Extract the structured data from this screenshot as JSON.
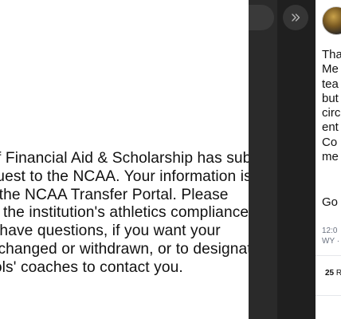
{
  "email": {
    "lines": [
      "Our office of Financial Aid & Scholarship has submitted your",
      "transfer request to the NCAA. Your information is now",
      "available in the NCAA Transfer Portal. Please",
      "reach out to the institution's athletics compliance",
      "office if you have questions, if you want your",
      "information changed or withdrawn, or to designate",
      "which schools' coaches to contact you."
    ]
  },
  "sidebar": {
    "collapse_icon": "double-chevron-right-icon"
  },
  "tweet": {
    "avatar_icon": "profile-avatar",
    "lines": [
      "Tha",
      "Me",
      "tea",
      "but",
      "circ",
      "ent",
      "Co",
      "me"
    ],
    "footer": "Go",
    "meta_lines": [
      "12:0",
      "WY ·"
    ],
    "stats": {
      "count": "25",
      "label": " R"
    }
  },
  "colors": {
    "dark_strip": "#1f1f1f",
    "meta_text": "#6b7280"
  }
}
